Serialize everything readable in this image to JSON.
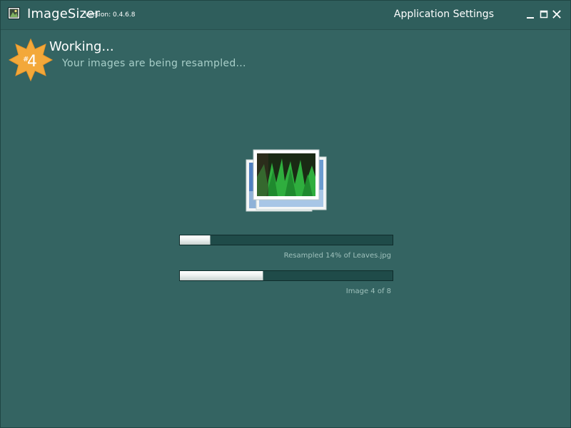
{
  "titlebar": {
    "app_name": "ImageSizer",
    "version": "Version: 0.4.6.8",
    "settings_link": "Application Settings",
    "minimize_icon": "minimize-icon",
    "maximize_icon": "maximize-icon",
    "close_icon": "close-icon"
  },
  "step": {
    "prefix": "#",
    "number": "4",
    "title": "Working...",
    "subtitle": "Your images are being resampled..."
  },
  "progress": {
    "current_file": {
      "fraction": 0.14,
      "label": "Resampled 14% of Leaves.jpg"
    },
    "overall": {
      "fraction": 0.39,
      "label": "Image 4 of 8"
    }
  },
  "colors": {
    "background": "#346462",
    "badge": "#f3a83a",
    "text_secondary": "#a8cfc9"
  }
}
